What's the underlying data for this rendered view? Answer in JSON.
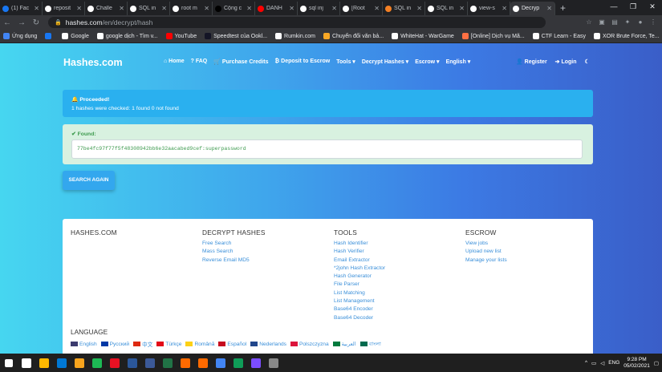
{
  "browser": {
    "tabs": [
      {
        "label": "(1) Fac",
        "color": "#1877f2"
      },
      {
        "label": "reposit",
        "color": "#ffffff"
      },
      {
        "label": "Challe",
        "color": "#ffffff"
      },
      {
        "label": "SQL in",
        "color": "#ffffff"
      },
      {
        "label": "root m",
        "color": "#ffffff"
      },
      {
        "label": "Cộng c",
        "color": "#000000"
      },
      {
        "label": "DANH",
        "color": "#ff0000"
      },
      {
        "label": "sql inj",
        "color": "#ffffff"
      },
      {
        "label": "[Root",
        "color": "#ffffff"
      },
      {
        "label": "SQL in",
        "color": "#f48024"
      },
      {
        "label": "SQL in",
        "color": "#ffffff"
      },
      {
        "label": "view-s",
        "color": "#ffffff"
      },
      {
        "label": "Decryp",
        "color": "#ffffff",
        "active": true
      }
    ],
    "url_host": "hashes.com",
    "url_path": "/en/decrypt/hash",
    "bookmarks": [
      {
        "label": "Ứng dụng",
        "color": "#4285f4"
      },
      {
        "label": "",
        "color": "#1877f2"
      },
      {
        "label": "Google",
        "color": "#ffffff"
      },
      {
        "label": "google dịch - Tìm v...",
        "color": "#ffffff"
      },
      {
        "label": "YouTube",
        "color": "#ff0000"
      },
      {
        "label": "Speedtest của Ookl...",
        "color": "#141526"
      },
      {
        "label": "Rumkin.com",
        "color": "#ffffff"
      },
      {
        "label": "Chuyển đổi văn bả...",
        "color": "#f9a825"
      },
      {
        "label": "WhiteHat - WarGame",
        "color": "#ffffff"
      },
      {
        "label": "[Online] Dịch vụ Mã...",
        "color": "#ff7043"
      },
      {
        "label": "CTF Learn - Easy",
        "color": "#ffffff"
      },
      {
        "label": "XOR Brute Force, Te...",
        "color": "#ffffff"
      }
    ]
  },
  "site": {
    "brand": "Hashes.com",
    "menu": [
      "⌂ Home",
      "? FAQ",
      "🛒 Purchase Credits",
      "₿ Deposit to Escrow",
      "Tools ▾",
      "Decrypt Hashes ▾",
      "Escrow ▾",
      "English ▾"
    ],
    "menu_right": [
      "👤 Register",
      "➔ Login",
      "☾"
    ]
  },
  "alert": {
    "title": "🔔 Proceeded!",
    "body": "1 hashes were checked: 1 found 0 not found"
  },
  "found": {
    "title": "✔ Found:",
    "result": "77be4fc97f77f5f48308942bb6e32aacabed9cef:superpassword"
  },
  "search_again": "SEARCH AGAIN",
  "footer": {
    "col1": {
      "title": "HASHES.COM"
    },
    "col2": {
      "title": "DECRYPT HASHES",
      "links": [
        "Free Search",
        "Mass Search",
        "Reverse Email MD5"
      ]
    },
    "col3": {
      "title": "TOOLS",
      "links": [
        "Hash Identifier",
        "Hash Verifier",
        "Email Extractor",
        "*2john Hash Extractor",
        "Hash Generator",
        "File Parser",
        "List Matching",
        "List Management",
        "Base64 Encoder",
        "Base64 Decoder"
      ]
    },
    "col4": {
      "title": "ESCROW",
      "links": [
        "View jobs",
        "Upload new list",
        "Manage your lists"
      ]
    },
    "language_title": "LANGUAGE",
    "languages": [
      {
        "label": "English",
        "color": "#3c3b6e"
      },
      {
        "label": "Русский",
        "color": "#0039a6"
      },
      {
        "label": "中文",
        "color": "#de2910"
      },
      {
        "label": "Türkçe",
        "color": "#e30a17"
      },
      {
        "label": "Română",
        "color": "#fcd116"
      },
      {
        "label": "Español",
        "color": "#c60b1e"
      },
      {
        "label": "Nederlands",
        "color": "#21468b"
      },
      {
        "label": "Polszczyzna",
        "color": "#dc143c"
      },
      {
        "label": "العربية",
        "color": "#007a3d"
      },
      {
        "label": "বাংলা",
        "color": "#006a4e"
      }
    ]
  },
  "taskbar": {
    "apps": [
      "#ffffff",
      "#ffb900",
      "#0078d4",
      "#f7a41d",
      "#1db954",
      "#e81123",
      "#2b579a",
      "#3b5998",
      "#217346",
      "#ff6a00",
      "#ff6a00",
      "#4285f4",
      "#0f9d58",
      "#7c4dff",
      "#888888"
    ],
    "lang": "ENG",
    "time": "9:28 PM",
    "date": "05/02/2021"
  }
}
